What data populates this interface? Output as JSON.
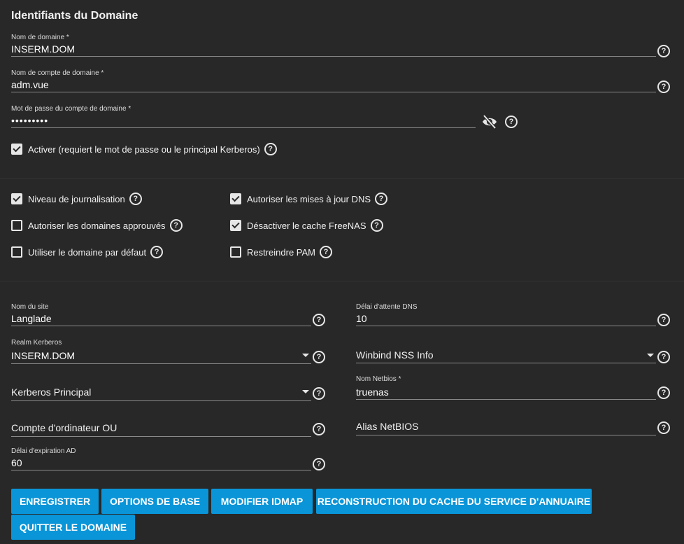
{
  "section_title": "Identifiants du Domaine",
  "domain_name": {
    "label": "Nom de domaine *",
    "value": "INSERM.DOM"
  },
  "domain_account": {
    "label": "Nom de compte de domaine *",
    "value": "adm.vue"
  },
  "domain_password": {
    "label": "Mot de passe du compte de domaine *",
    "value": "•••••••••"
  },
  "enable": {
    "label": "Activer (requiert le mot de passe ou le principal Kerberos)",
    "checked": true
  },
  "options": {
    "verbose_logging": {
      "label": "Niveau de journalisation",
      "checked": true
    },
    "trusted_domains": {
      "label": "Autoriser les domaines approuvés",
      "checked": false
    },
    "default_domain": {
      "label": "Utiliser le domaine par défaut",
      "checked": false
    },
    "dns_updates": {
      "label": "Autoriser les mises à jour DNS",
      "checked": true
    },
    "disable_cache": {
      "label": "Désactiver le cache FreeNAS",
      "checked": true
    },
    "restrict_pam": {
      "label": "Restreindre PAM",
      "checked": false
    }
  },
  "site_name": {
    "label": "Nom du site",
    "value": "Langlade"
  },
  "kerberos_realm": {
    "label": "Realm Kerberos",
    "value": "INSERM.DOM"
  },
  "kerberos_principal": {
    "placeholder": "Kerberos Principal"
  },
  "computer_ou": {
    "placeholder": "Compte d'ordinateur OU"
  },
  "ad_timeout": {
    "label": "Délai d'expiration AD",
    "value": "60"
  },
  "dns_timeout": {
    "label": "Délai d'attente DNS",
    "value": "10"
  },
  "winbind_nss": {
    "placeholder": "Winbind NSS Info"
  },
  "netbios_name": {
    "label": "Nom Netbios *",
    "value": "truenas"
  },
  "netbios_alias": {
    "placeholder": "Alias NetBIOS"
  },
  "buttons": {
    "save": "ENREGISTRER",
    "basic_options": "OPTIONS DE BASE",
    "edit_idmap": "MODIFIER IDMAP",
    "rebuild_cache": "RECONSTRUCTION DU CACHE DU SERVICE D'ANNUAIRE",
    "leave_domain": "QUITTER LE DOMAINE"
  },
  "colors": {
    "background": "#282828",
    "accent": "#0a95d8"
  }
}
